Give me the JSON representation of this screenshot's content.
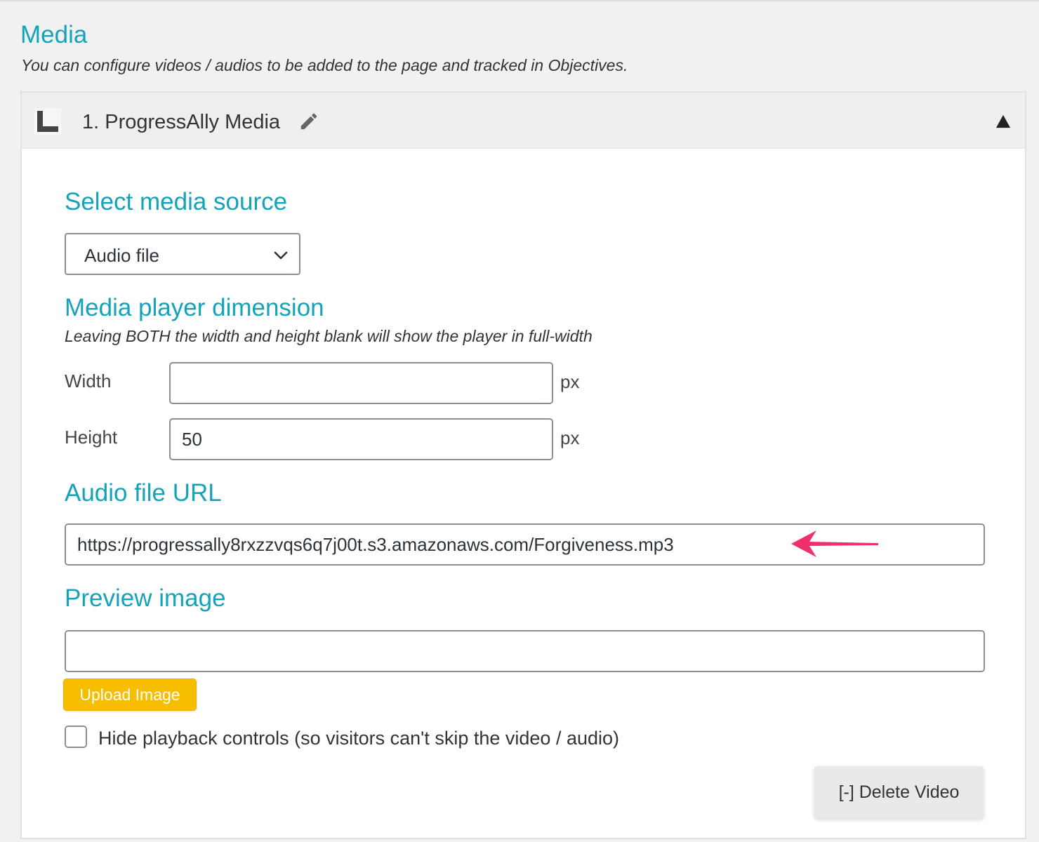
{
  "section": {
    "title": "Media",
    "description": "You can configure videos / audios to be added to the page and tracked in Objectives."
  },
  "panel": {
    "title": "1. ProgressAlly Media",
    "handle_icon": "drag-handle-icon",
    "edit_icon": "pencil-icon",
    "collapse_icon": "triangle-up-icon"
  },
  "media_source": {
    "heading": "Select media source",
    "selected": "Audio file"
  },
  "dimension": {
    "heading": "Media player dimension",
    "hint": "Leaving BOTH the width and height blank will show the player in full-width",
    "width_label": "Width",
    "width_value": "",
    "height_label": "Height",
    "height_value": "50",
    "unit": "px"
  },
  "audio_url": {
    "heading": "Audio file URL",
    "value": "https://progressally8rxzzvqs6q7j00t.s3.amazonaws.com/Forgiveness.mp3"
  },
  "preview_image": {
    "heading": "Preview image",
    "value": "",
    "upload_label": "Upload Image"
  },
  "playback": {
    "checked": false,
    "label": "Hide playback controls (so visitors can't skip the video / audio)"
  },
  "delete_label": "[-] Delete Video",
  "colors": {
    "accent": "#14a3b8",
    "upload_button": "#f7be00",
    "annotation_arrow": "#f0306a"
  }
}
